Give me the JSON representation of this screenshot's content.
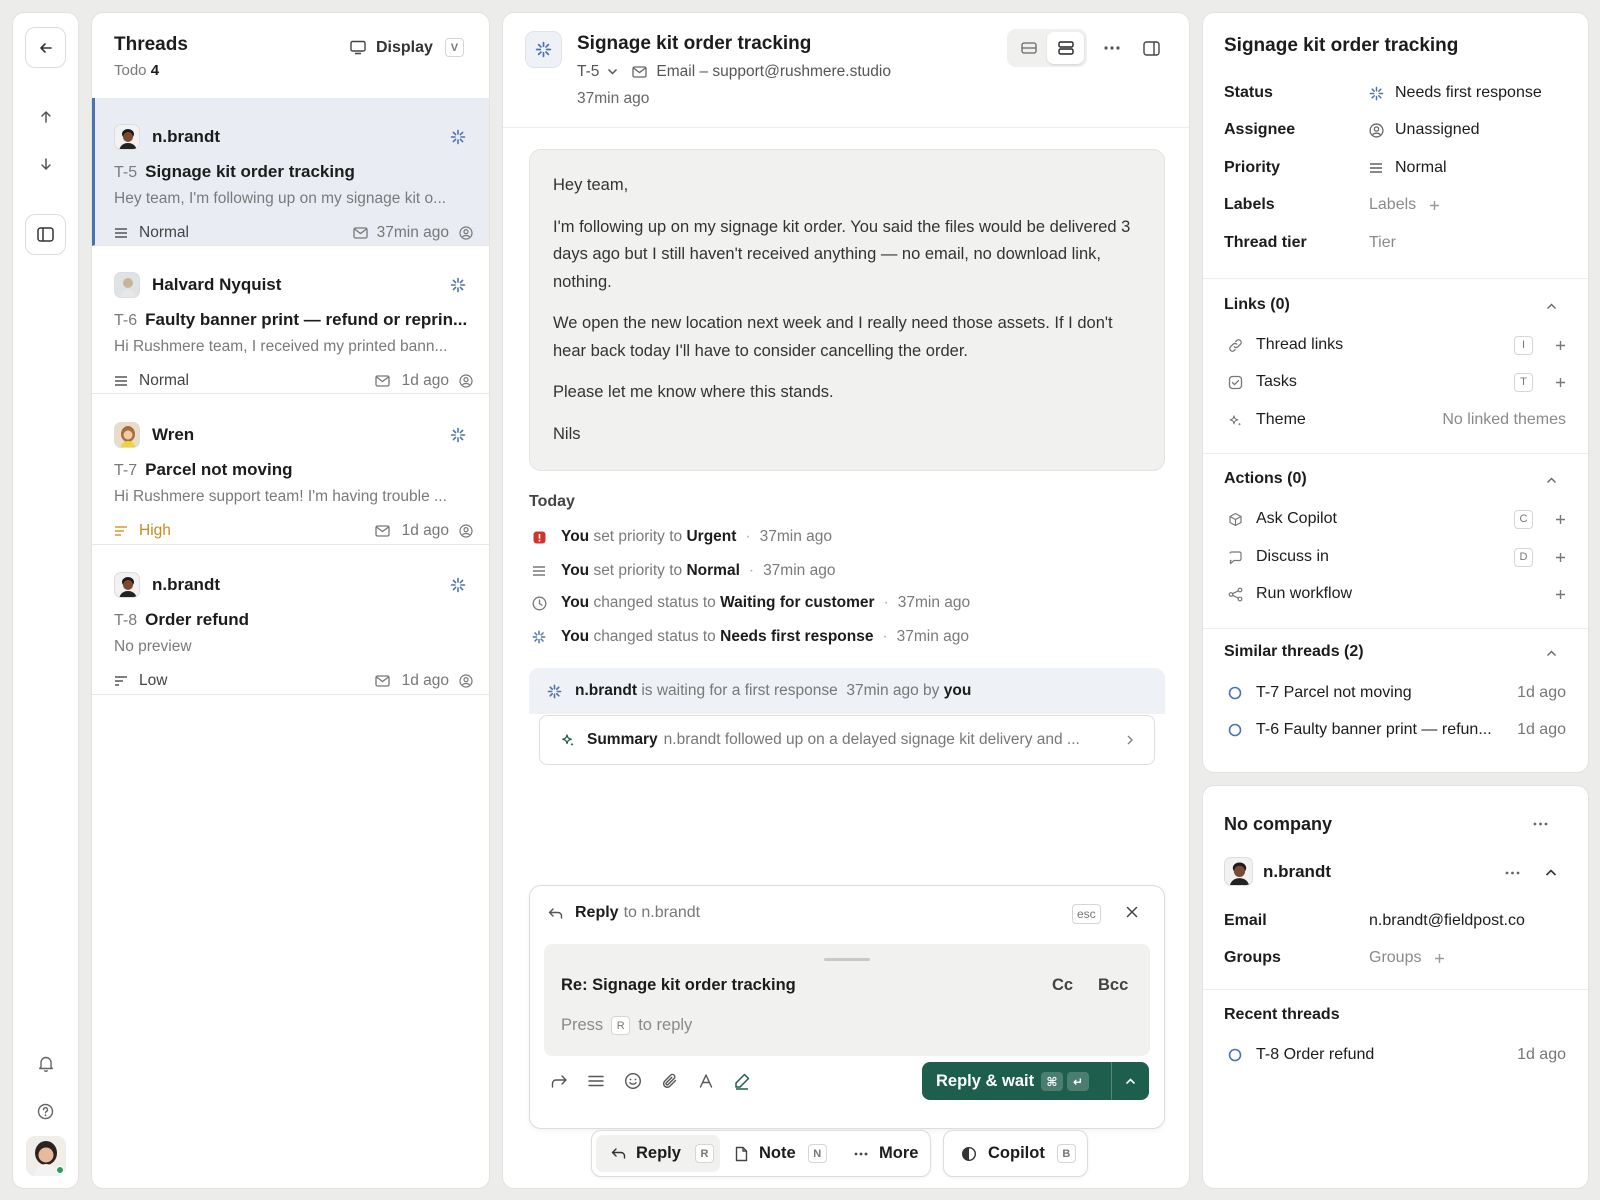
{
  "colors": {
    "accent": "#1e5e4c",
    "selected_bg": "#e9edf3",
    "status_blue": "#4c72b0",
    "urgent": "#d0352b",
    "high": "#d49a2a"
  },
  "threads_panel": {
    "title": "Threads",
    "subtitle_label": "Todo",
    "subtitle_count": "4",
    "display_label": "Display",
    "display_key": "V",
    "items": [
      {
        "author": "n.brandt",
        "id": "T-5",
        "title": "Signage kit order tracking",
        "preview": "Hey team, I'm following up on my signage kit o...",
        "priority": "Normal",
        "time": "37min ago"
      },
      {
        "author": "Halvard Nyquist",
        "id": "T-6",
        "title": "Faulty banner print — refund or reprin...",
        "preview": "Hi Rushmere team, I received my printed bann...",
        "priority": "Normal",
        "time": "1d ago"
      },
      {
        "author": "Wren",
        "id": "T-7",
        "title": "Parcel not moving",
        "preview": "Hi Rushmere support team! I'm having trouble ...",
        "priority": "High",
        "time": "1d ago"
      },
      {
        "author": "n.brandt",
        "id": "T-8",
        "title": "Order refund",
        "preview": "No preview",
        "priority": "Low",
        "time": "1d ago"
      }
    ]
  },
  "conversation": {
    "title": "Signage kit order tracking",
    "id": "T-5",
    "channel": "Email – support@rushmere.studio",
    "time": "37min ago",
    "message": {
      "greeting": "Hey team,",
      "p1": "I'm following up on my signage kit order. You said the files would be delivered 3 days ago but I still haven't received anything — no email, no download link, nothing.",
      "p2": "We open the new location next week and I really need those assets. If I don't hear back today I'll have to consider cancelling the order.",
      "p3": "Please let me know where this stands.",
      "signoff": "Nils"
    },
    "today_label": "Today",
    "activity": [
      {
        "actor": "You",
        "verb": "set priority to",
        "value": "Urgent",
        "time": "37min ago"
      },
      {
        "actor": "You",
        "verb": "set priority to",
        "value": "Normal",
        "time": "37min ago"
      },
      {
        "actor": "You",
        "verb": "changed status to",
        "value": "Waiting for customer",
        "time": "37min ago"
      },
      {
        "actor": "You",
        "verb": "changed status to",
        "value": "Needs first response",
        "time": "37min ago"
      }
    ],
    "waiting": {
      "who": "n.brandt",
      "text": "is waiting for a first response",
      "time": "37min ago by",
      "by": "you"
    },
    "summary": {
      "label": "Summary",
      "text": "n.brandt followed up on a delayed signage kit delivery and ..."
    },
    "composer": {
      "reply_label": "Reply",
      "to_text": "to n.brandt",
      "esc": "esc",
      "subject": "Re: Signage kit order tracking",
      "cc": "Cc",
      "bcc": "Bcc",
      "press": "Press",
      "press_key": "R",
      "to_reply": "to reply",
      "send_label": "Reply & wait",
      "send_key1": "⌘",
      "send_key2": "↵"
    },
    "bottom_bar": {
      "reply": "Reply",
      "reply_key": "R",
      "note": "Note",
      "note_key": "N",
      "more": "More",
      "copilot": "Copilot",
      "copilot_key": "B"
    }
  },
  "details": {
    "title": "Signage kit order tracking",
    "props": {
      "status_label": "Status",
      "status_value": "Needs first response",
      "assignee_label": "Assignee",
      "assignee_value": "Unassigned",
      "priority_label": "Priority",
      "priority_value": "Normal",
      "labels_label": "Labels",
      "labels_value": "Labels",
      "tier_label": "Thread tier",
      "tier_value": "Tier"
    },
    "links": {
      "title": "Links (0)",
      "items": [
        {
          "label": "Thread links",
          "key": "I"
        },
        {
          "label": "Tasks",
          "key": "T"
        },
        {
          "label": "Theme",
          "note": "No linked themes"
        }
      ]
    },
    "actions": {
      "title": "Actions (0)",
      "items": [
        {
          "label": "Ask Copilot",
          "key": "C"
        },
        {
          "label": "Discuss in",
          "key": "D"
        },
        {
          "label": "Run workflow"
        }
      ]
    },
    "similar": {
      "title": "Similar threads (2)",
      "items": [
        {
          "label": "T-7 Parcel not moving",
          "time": "1d ago"
        },
        {
          "label": "T-6 Faulty banner print — refun...",
          "time": "1d ago"
        }
      ]
    }
  },
  "company": {
    "title": "No company",
    "contact": "n.brandt",
    "email_label": "Email",
    "email_value": "n.brandt@fieldpost.co",
    "groups_label": "Groups",
    "groups_value": "Groups",
    "recent_title": "Recent threads",
    "recent": [
      {
        "label": "T-8 Order refund",
        "time": "1d ago"
      }
    ]
  }
}
